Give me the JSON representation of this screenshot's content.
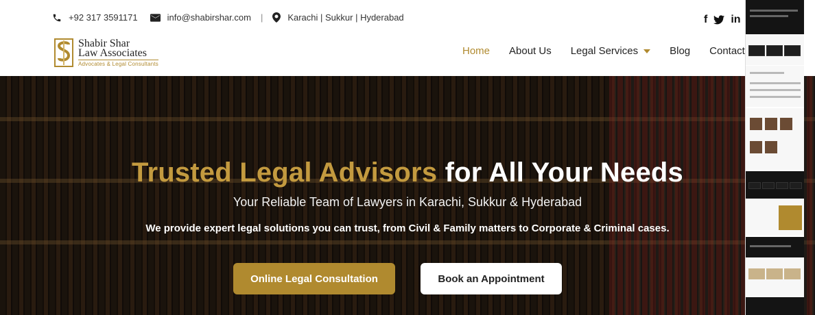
{
  "topbar": {
    "phone": "+92 317 3591171",
    "email": "info@shabirshar.com",
    "locations": "Karachi | Sukkur | Hyderabad",
    "separator": "|",
    "icons": [
      "phone-icon",
      "mail-icon",
      "location-pin-icon"
    ]
  },
  "social": {
    "facebook": "f",
    "twitter_icon": "twitter-icon",
    "linkedin": "in"
  },
  "brand": {
    "line1": "Shabir Shar",
    "line2": "Law Associates",
    "tagline": "Advocates & Legal Consultants",
    "accent": "#b08a2f"
  },
  "nav": {
    "items": [
      {
        "label": "Home",
        "active": true
      },
      {
        "label": "About Us"
      },
      {
        "label": "Legal Services",
        "dropdown": true
      },
      {
        "label": "Blog"
      },
      {
        "label": "Contact U"
      }
    ]
  },
  "hero": {
    "title_gold": "Trusted Legal Advisors",
    "title_white": "for All Your Needs",
    "subtitle": "Your Reliable Team of Lawyers in Karachi, Sukkur & Hyderabad",
    "description": "We provide expert legal solutions you can trust, from Civil & Family matters to Corporate & Criminal cases.",
    "buttons": {
      "primary": "Online Legal Consultation",
      "secondary": "Book an Appointment"
    }
  }
}
